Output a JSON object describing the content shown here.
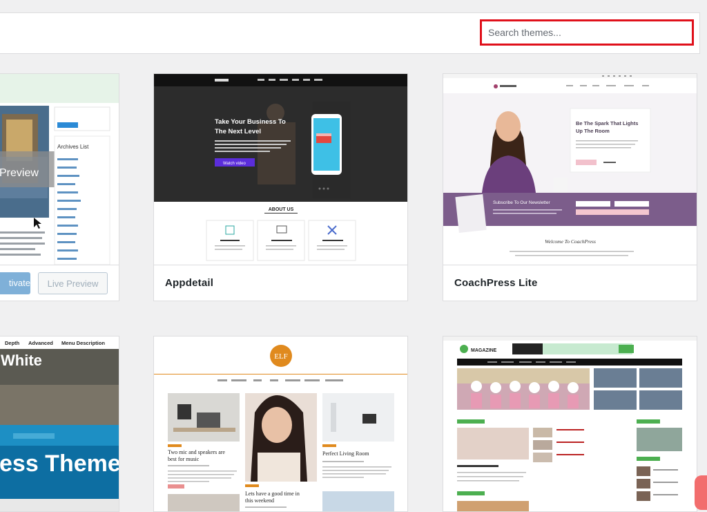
{
  "search": {
    "placeholder": "Search themes..."
  },
  "cards": [
    {
      "name": "",
      "preview_overlay": "Preview",
      "sidebar_button": "",
      "sidebar_heading": "Archives List",
      "activate_label": "tivate",
      "live_preview_label": "Live Preview"
    },
    {
      "name": "Appdetail",
      "hero_line1": "Take Your Business To",
      "hero_line2": "The Next Level",
      "cta": "Watch video",
      "section_title": "ABOUT US"
    },
    {
      "name": "CoachPress Lite",
      "hero_line1": "Be The Spark That Lights",
      "hero_line2": "Up The Room",
      "newsletter": "Subscribe To Our Newsletter",
      "welcome": "Welcome To CoachPress"
    },
    {
      "menu": [
        "Depth",
        "Advanced",
        "Menu Description"
      ],
      "title_top": "White",
      "title_bottom": "ess Theme"
    },
    {
      "logo": "ELF",
      "post1": "Two mic and speakers are best for music",
      "post2": "Perfect Living Room",
      "post3": "Lets have a good time in this weekend"
    },
    {
      "logo": "MAGAZINE"
    }
  ],
  "colors": {
    "search_highlight": "#e0101a",
    "accent": "#2271b1"
  }
}
